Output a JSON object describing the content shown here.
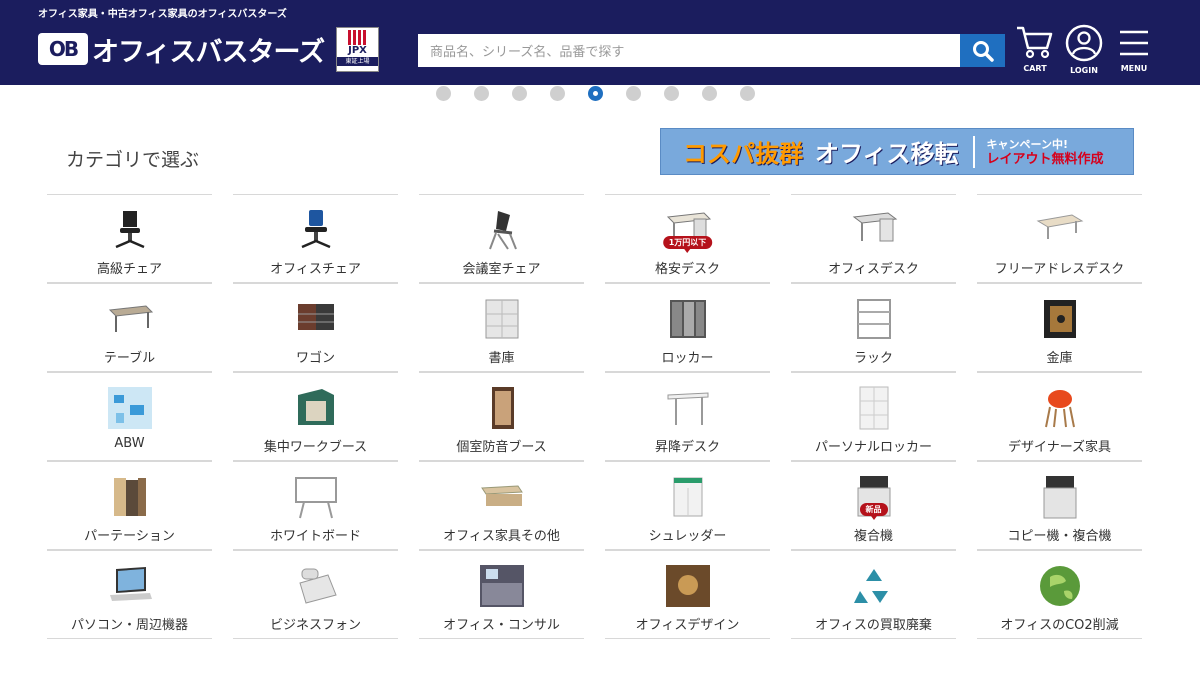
{
  "header": {
    "tagline": "オフィス家具・中古オフィス家具のオフィスバスターズ",
    "logo_mark": "OB",
    "logo_text": "オフィスバスターズ",
    "jpx_label": "JPX",
    "jpx_sub": "東証上場",
    "search_placeholder": "商品名、シリーズ名、品番で探す",
    "cart_label": "CART",
    "login_label": "LOGIN",
    "menu_label": "MENU"
  },
  "carousel": {
    "count": 9,
    "active_index": 4
  },
  "section": {
    "title": "カテゴリで選ぶ"
  },
  "banner": {
    "main1": "コスパ抜群",
    "main2": "オフィス移転",
    "sub1": "キャンペーン中!",
    "sub2": "レイアウト無料作成"
  },
  "categories": [
    {
      "label": "高級チェア",
      "icon": "executive-chair-icon"
    },
    {
      "label": "オフィスチェア",
      "icon": "office-chair-icon"
    },
    {
      "label": "会議室チェア",
      "icon": "meeting-chair-icon"
    },
    {
      "label": "格安デスク",
      "icon": "budget-desk-icon",
      "badge": "1万円以下"
    },
    {
      "label": "オフィスデスク",
      "icon": "office-desk-icon"
    },
    {
      "label": "フリーアドレスデスク",
      "icon": "free-address-desk-icon"
    },
    {
      "label": "テーブル",
      "icon": "table-icon"
    },
    {
      "label": "ワゴン",
      "icon": "wagon-icon"
    },
    {
      "label": "書庫",
      "icon": "bookcase-icon"
    },
    {
      "label": "ロッカー",
      "icon": "locker-icon"
    },
    {
      "label": "ラック",
      "icon": "rack-icon"
    },
    {
      "label": "金庫",
      "icon": "safe-icon"
    },
    {
      "label": "ABW",
      "icon": "abw-icon"
    },
    {
      "label": "集中ワークブース",
      "icon": "focus-booth-icon"
    },
    {
      "label": "個室防音ブース",
      "icon": "soundproof-booth-icon"
    },
    {
      "label": "昇降デスク",
      "icon": "standing-desk-icon"
    },
    {
      "label": "パーソナルロッカー",
      "icon": "personal-locker-icon"
    },
    {
      "label": "デザイナーズ家具",
      "icon": "designer-chair-icon"
    },
    {
      "label": "パーテーション",
      "icon": "partition-icon"
    },
    {
      "label": "ホワイトボード",
      "icon": "whiteboard-icon"
    },
    {
      "label": "オフィス家具その他",
      "icon": "other-furniture-icon"
    },
    {
      "label": "シュレッダー",
      "icon": "shredder-icon"
    },
    {
      "label": "複合機",
      "icon": "multifunction-printer-icon",
      "badge": "新品"
    },
    {
      "label": "コピー機・複合機",
      "icon": "copier-icon"
    },
    {
      "label": "パソコン・周辺機器",
      "icon": "laptop-icon"
    },
    {
      "label": "ビジネスフォン",
      "icon": "business-phone-icon"
    },
    {
      "label": "オフィス・コンサル",
      "icon": "consulting-icon"
    },
    {
      "label": "オフィスデザイン",
      "icon": "office-design-icon"
    },
    {
      "label": "オフィスの買取廃棄",
      "icon": "recycle-icon"
    },
    {
      "label": "オフィスのCO2削減",
      "icon": "co2-globe-icon"
    }
  ],
  "colors": {
    "header_bg": "#1b1d5e",
    "accent": "#1f6fc0",
    "badge": "#b5121b"
  }
}
